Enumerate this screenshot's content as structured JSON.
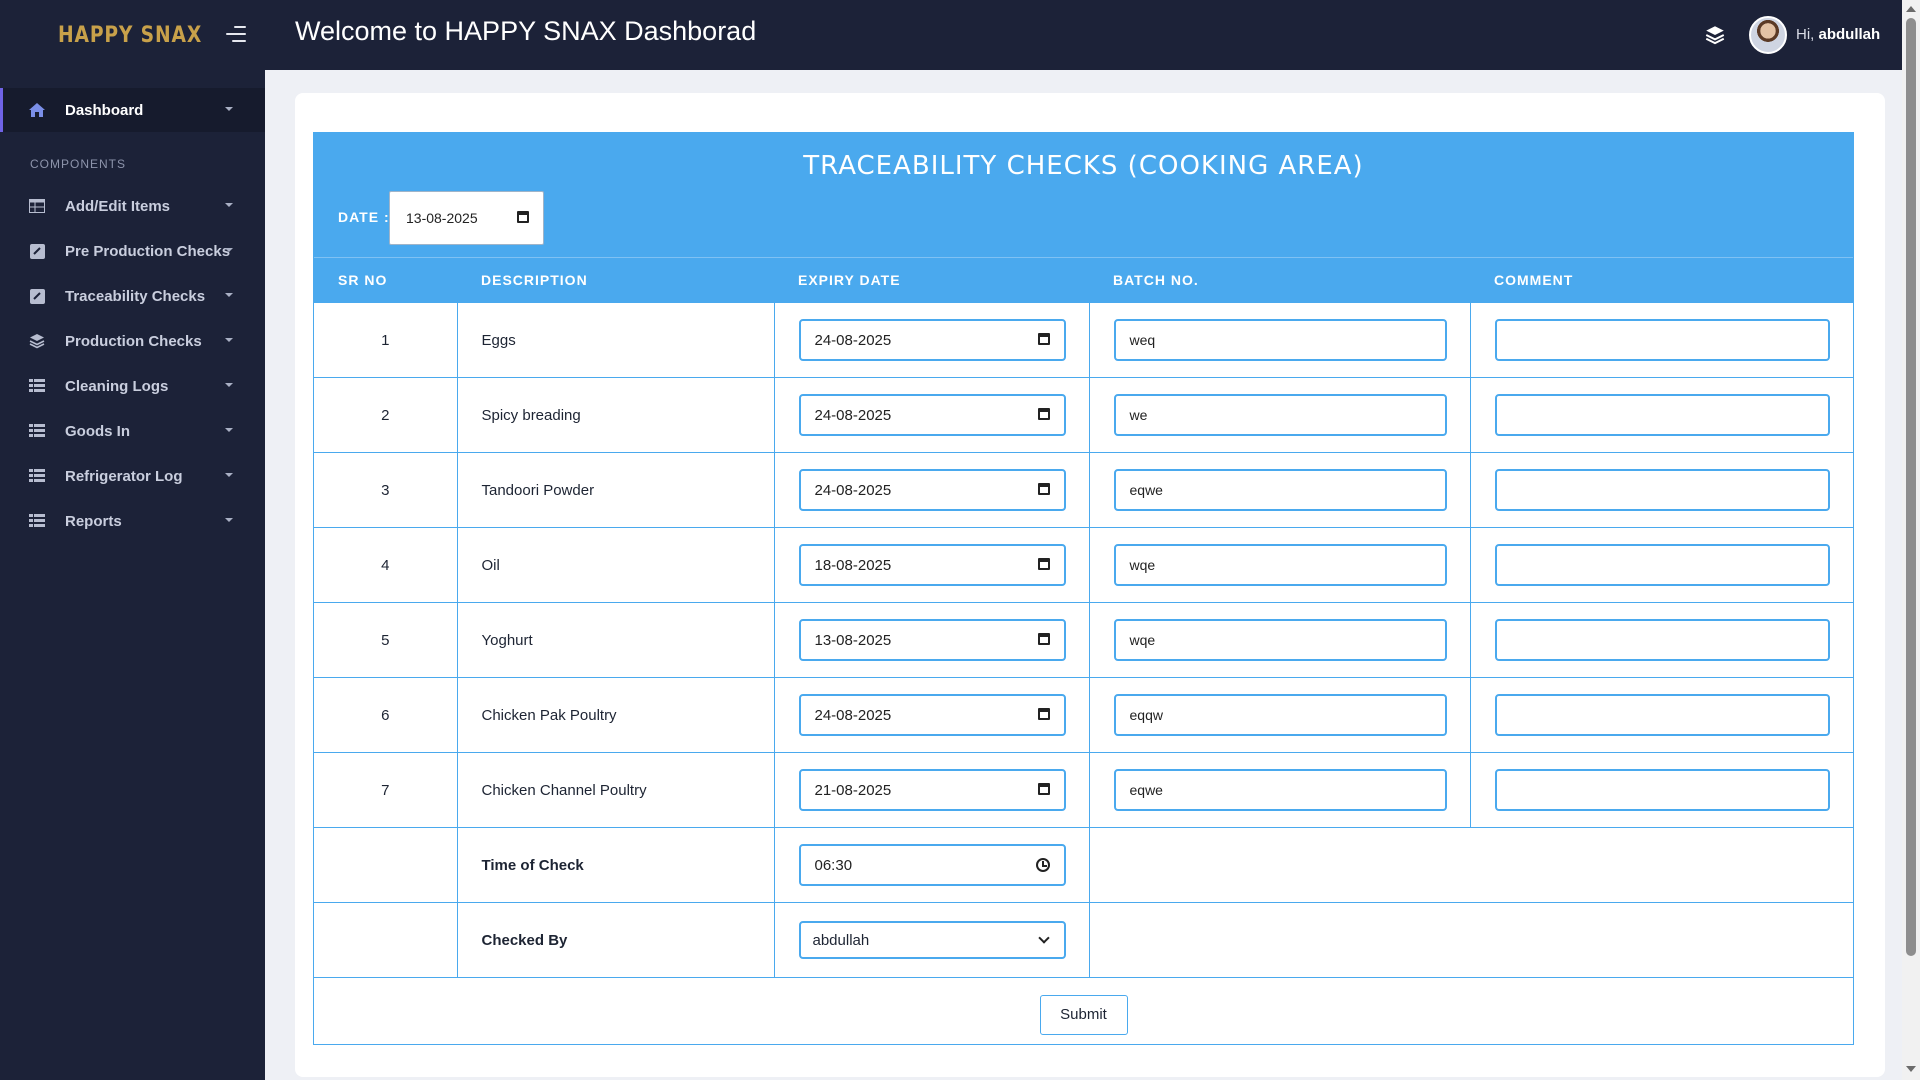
{
  "app": {
    "brand": "HAPPY SNAX",
    "title": "Welcome to HAPPY SNAX Dashborad",
    "greeting_prefix": "Hi, ",
    "user_name": "abdullah"
  },
  "colors": {
    "sidebar_bg": "#1c2238",
    "accent_blue": "#4aa9ee",
    "brand_gold": "#c8a14a",
    "active_indicator": "#6f63e6"
  },
  "sidebar": {
    "dashboard": {
      "label": "Dashboard",
      "icon": "home-icon"
    },
    "section_label": "COMPONENTS",
    "items": [
      {
        "label": "Add/Edit Items",
        "icon": "table-icon"
      },
      {
        "label": "Pre Production Checks",
        "icon": "checkbox-icon"
      },
      {
        "label": "Traceability Checks",
        "icon": "checkbox-icon"
      },
      {
        "label": "Production Checks",
        "icon": "layers-icon"
      },
      {
        "label": "Cleaning Logs",
        "icon": "list-icon"
      },
      {
        "label": "Goods In",
        "icon": "list-icon"
      },
      {
        "label": "Refrigerator Log",
        "icon": "list-icon"
      },
      {
        "label": "Reports",
        "icon": "list-icon"
      }
    ]
  },
  "form": {
    "title": "TRACEABILITY CHECKS (COOKING AREA)",
    "date_label": "DATE :",
    "date_value": "13-08-2025",
    "columns": [
      "SR NO",
      "DESCRIPTION",
      "EXPIRY DATE",
      "BATCH NO.",
      "COMMENT"
    ],
    "rows": [
      {
        "sr": "1",
        "description": "Eggs",
        "expiry": "24-08-2025",
        "batch": "weq",
        "comment": ""
      },
      {
        "sr": "2",
        "description": "Spicy breading",
        "expiry": "24-08-2025",
        "batch": "we",
        "comment": ""
      },
      {
        "sr": "3",
        "description": "Tandoori Powder",
        "expiry": "24-08-2025",
        "batch": "eqwe",
        "comment": ""
      },
      {
        "sr": "4",
        "description": "Oil",
        "expiry": "18-08-2025",
        "batch": "wqe",
        "comment": ""
      },
      {
        "sr": "5",
        "description": "Yoghurt",
        "expiry": "13-08-2025",
        "batch": "wqe",
        "comment": ""
      },
      {
        "sr": "6",
        "description": "Chicken Pak Poultry",
        "expiry": "24-08-2025",
        "batch": "eqqw",
        "comment": ""
      },
      {
        "sr": "7",
        "description": "Chicken Channel Poultry",
        "expiry": "21-08-2025",
        "batch": "eqwe",
        "comment": ""
      }
    ],
    "time_label": "Time of Check",
    "time_value": "06:30",
    "checked_by_label": "Checked By",
    "checked_by_value": "abdullah",
    "submit_label": "Submit"
  }
}
